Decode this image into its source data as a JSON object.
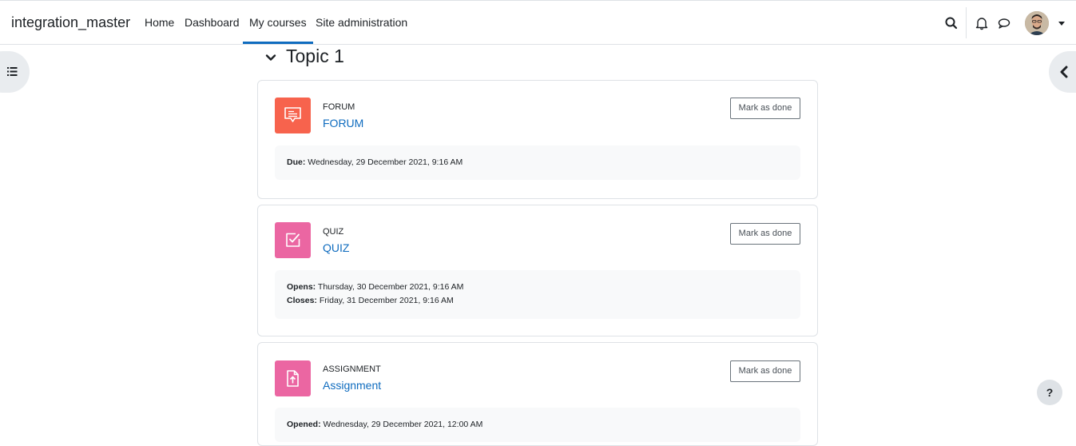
{
  "navbar": {
    "brand": "integration_master",
    "links": [
      {
        "label": "Home"
      },
      {
        "label": "Dashboard"
      },
      {
        "label": "My courses"
      },
      {
        "label": "Site administration"
      }
    ],
    "icons": [
      "search-icon",
      "bell-icon",
      "chat-icon",
      "avatar",
      "chevron-down-icon"
    ]
  },
  "section": {
    "title": "Topic 1"
  },
  "activities": [
    {
      "type": "FORUM",
      "name": "FORUM",
      "icon": "forum-icon",
      "color": "#f7634d",
      "mark_label": "Mark as done",
      "dates": [
        {
          "label": "Due:",
          "value": "Wednesday, 29 December 2021, 9:16 AM"
        }
      ]
    },
    {
      "type": "QUIZ",
      "name": "QUIZ",
      "icon": "quiz-icon",
      "color": "#eb66a2",
      "mark_label": "Mark as done",
      "dates": [
        {
          "label": "Opens:",
          "value": "Thursday, 30 December 2021, 9:16 AM"
        },
        {
          "label": "Closes:",
          "value": "Friday, 31 December 2021, 9:16 AM"
        }
      ]
    },
    {
      "type": "ASSIGNMENT",
      "name": "Assignment",
      "icon": "assignment-icon",
      "color": "#eb66a2",
      "mark_label": "Mark as done",
      "dates": [
        {
          "label": "Opened:",
          "value": "Wednesday, 29 December 2021, 12:00 AM"
        }
      ]
    }
  ],
  "help": {
    "label": "?"
  },
  "colors": {
    "link": "#0f6cbf",
    "border": "#dee2e6",
    "drawer": "#e9ecef"
  }
}
